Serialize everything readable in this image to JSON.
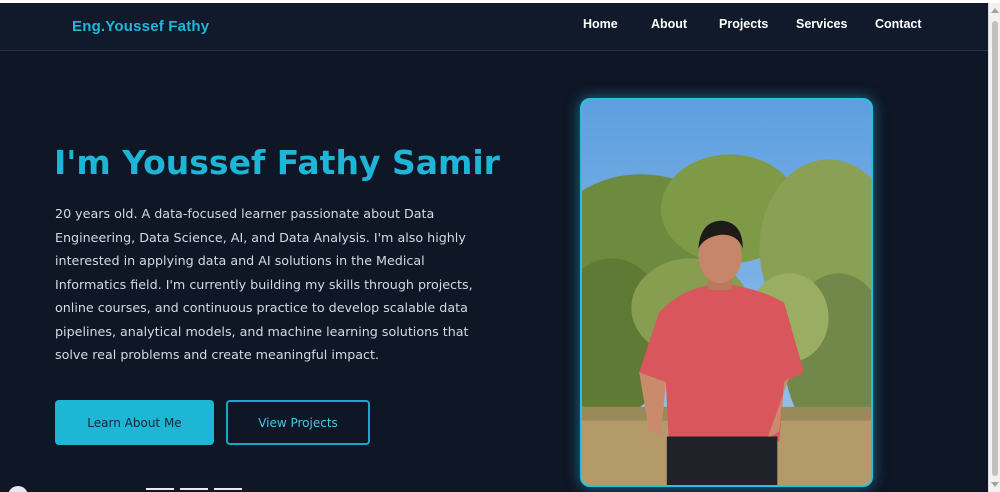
{
  "brand": "Eng.Youssef Fathy",
  "nav": [
    {
      "label": "Home"
    },
    {
      "label": "About"
    },
    {
      "label": "Projects"
    },
    {
      "label": "Services"
    },
    {
      "label": "Contact"
    }
  ],
  "hero": {
    "title": "I'm Youssef Fathy Samir",
    "description": "20 years old. A data-focused learner passionate about Data Engineering, Data Science, AI, and Data Analysis. I'm also highly interested in applying data and AI solutions in the Medical Informatics field. I'm currently building my skills through projects, online courses, and continuous practice to develop scalable data pipelines, analytical models, and machine learning solutions that solve real problems and create meaningful impact.",
    "primary_button": "Learn About Me",
    "secondary_button": "View Projects"
  },
  "colors": {
    "background": "#0f1626",
    "accent": "#1fb5d6",
    "navbar": "#111a2b"
  }
}
